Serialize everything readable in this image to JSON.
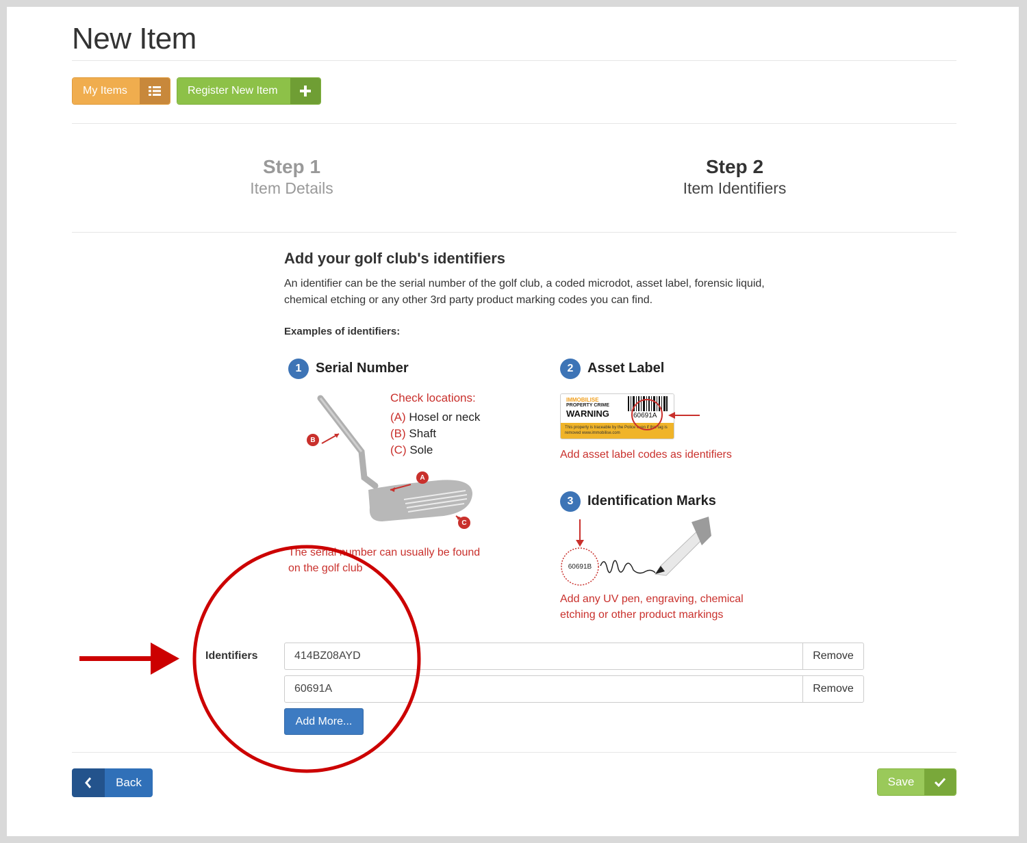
{
  "page": {
    "title": "New Item"
  },
  "nav": {
    "my_items_label": "My Items",
    "register_label": "Register New Item"
  },
  "steps": [
    {
      "number": "Step 1",
      "name": "Item Details"
    },
    {
      "number": "Step 2",
      "name": "Item Identifiers"
    }
  ],
  "content": {
    "heading": "Add your golf club's identifiers",
    "intro": "An identifier can be the serial number of the golf club, a coded microdot, asset label, forensic liquid, chemical etching or any other 3rd party product marking codes you can find.",
    "examples_label": "Examples of identifiers:"
  },
  "examples": {
    "serial": {
      "badge": "1",
      "title": "Serial Number",
      "check_heading": "Check locations:",
      "locations": [
        {
          "key": "(A)",
          "text": "Hosel or neck"
        },
        {
          "key": "(B)",
          "text": "Shaft"
        },
        {
          "key": "(C)",
          "text": "Sole"
        }
      ],
      "markers": [
        "A",
        "B",
        "C"
      ],
      "note_line1": "The serial number can usually be found",
      "note_line2": "on the golf club"
    },
    "asset": {
      "badge": "2",
      "title": "Asset Label",
      "label_brand": "IMMOBILISE",
      "label_sub": "PROPERTY CRIME",
      "label_warning": "WARNING",
      "label_code": "60691A",
      "label_footer": "This property is traceable by the Police even if this tag is removed  www.immobilise.com",
      "note": "Add asset label codes as identifiers"
    },
    "marks": {
      "badge": "3",
      "title": "Identification Marks",
      "code": "60691B",
      "note_line1": "Add any UV pen, engraving, chemical",
      "note_line2": "etching or other product markings"
    }
  },
  "form": {
    "label": "Identifiers",
    "identifiers": [
      {
        "value": "414BZ08AYD",
        "remove_label": "Remove"
      },
      {
        "value": "60691A",
        "remove_label": "Remove"
      }
    ],
    "add_more_label": "Add More..."
  },
  "footer": {
    "back_label": "Back",
    "save_label": "Save"
  },
  "colors": {
    "annotation_red": "#cc0000",
    "primary_blue": "#3d7bc2",
    "success_green": "#9ac95a",
    "warning_orange": "#f0ad4e"
  }
}
